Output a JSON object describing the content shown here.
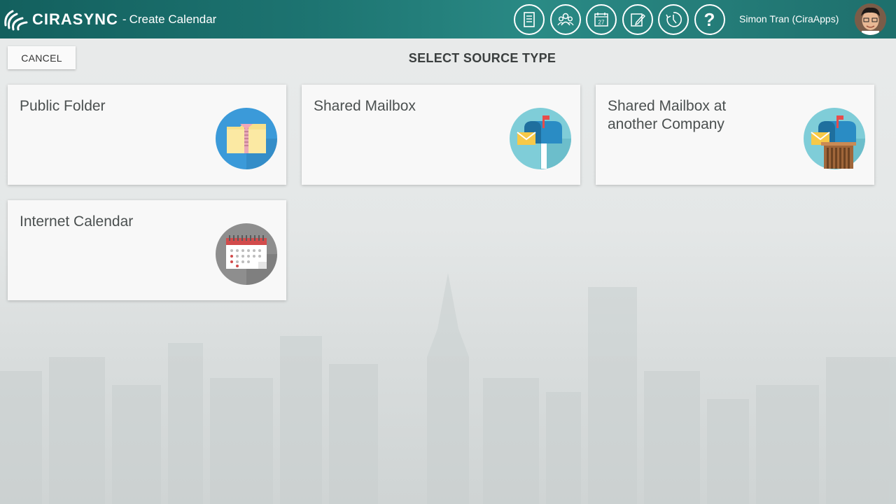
{
  "header": {
    "brand": "CIRASYNC",
    "separator": "-",
    "page_title": "Create Calendar",
    "user_name": "Simon Tran (CiraApps)",
    "nav_icons": [
      {
        "name": "document-list-icon"
      },
      {
        "name": "users-group-icon"
      },
      {
        "name": "calendar-icon",
        "label": "27"
      },
      {
        "name": "edit-icon"
      },
      {
        "name": "history-icon"
      },
      {
        "name": "help-icon",
        "label": "?"
      }
    ]
  },
  "toolbar": {
    "cancel_label": "CANCEL"
  },
  "main": {
    "title": "SELECT SOURCE TYPE",
    "cards": [
      {
        "label": "Public Folder",
        "icon": "zip-folder-icon",
        "icon_bg": "#3b9ad9"
      },
      {
        "label": "Shared Mailbox",
        "icon": "mailbox-icon",
        "icon_bg": "#7fcdd8"
      },
      {
        "label": "Shared Mailbox at another Company",
        "icon": "mailbox-building-icon",
        "icon_bg": "#7fcdd8"
      },
      {
        "label": "Internet Calendar",
        "icon": "internet-calendar-icon",
        "icon_bg": "#8e8e8e"
      }
    ]
  },
  "colors": {
    "topbar": "#1d7471",
    "card_bg": "#f8f8f8",
    "text": "#4b5050"
  }
}
